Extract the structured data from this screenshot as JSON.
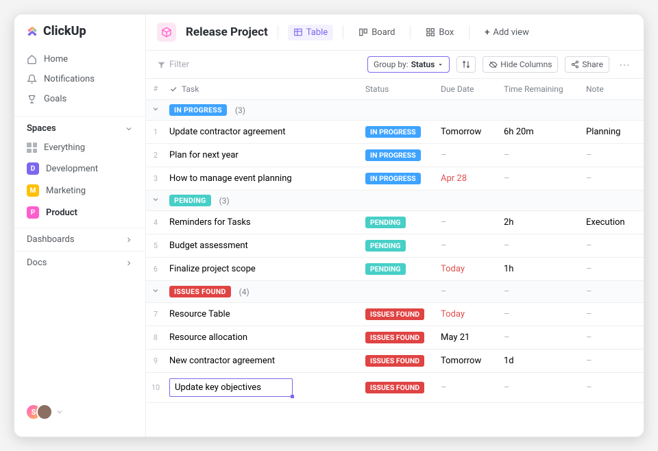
{
  "brand": {
    "name": "ClickUp"
  },
  "sidebar": {
    "nav": [
      {
        "label": "Home"
      },
      {
        "label": "Notifications"
      },
      {
        "label": "Goals"
      }
    ],
    "spaces_header": "Spaces",
    "everything": "Everything",
    "spaces": [
      {
        "letter": "D",
        "label": "Development",
        "color": "#7b68ee"
      },
      {
        "letter": "M",
        "label": "Marketing",
        "color": "#ffc107"
      },
      {
        "letter": "P",
        "label": "Product",
        "color": "#ff5ecd",
        "active": true
      }
    ],
    "dashboards": "Dashboards",
    "docs": "Docs",
    "avatar_letter": "S"
  },
  "header": {
    "project_title": "Release Project",
    "views": [
      {
        "label": "Table",
        "active": true
      },
      {
        "label": "Board"
      },
      {
        "label": "Box"
      }
    ],
    "add_view": "Add view"
  },
  "toolbar": {
    "filter": "Filter",
    "group_by_prefix": "Group by:",
    "group_by_value": "Status",
    "hide_columns": "Hide Columns",
    "share": "Share"
  },
  "columns": {
    "num": "#",
    "task": "Task",
    "status": "Status",
    "due": "Due Date",
    "time": "Time Remaining",
    "note": "Note"
  },
  "status_colors": {
    "IN PROGRESS": "#3ea3ff",
    "PENDING": "#46cfc7",
    "ISSUES FOUND": "#e04343"
  },
  "groups": [
    {
      "status": "IN PROGRESS",
      "count": "(3)",
      "rows": [
        {
          "n": "1",
          "task": "Update contractor agreement",
          "status": "IN PROGRESS",
          "due": "Tomorrow",
          "time": "6h 20m",
          "note": "Planning"
        },
        {
          "n": "2",
          "task": "Plan for next year",
          "status": "IN PROGRESS",
          "due": "–",
          "time": "–",
          "note": "–"
        },
        {
          "n": "3",
          "task": "How to manage event planning",
          "status": "IN PROGRESS",
          "due": "Apr 28",
          "due_red": true,
          "time": "–",
          "note": "–"
        }
      ]
    },
    {
      "status": "PENDING",
      "count": "(3)",
      "rows": [
        {
          "n": "4",
          "task": "Reminders for Tasks",
          "status": "PENDING",
          "due": "–",
          "time": "2h",
          "note": "Execution"
        },
        {
          "n": "5",
          "task": "Budget assessment",
          "status": "PENDING",
          "due": "–",
          "time": "–",
          "note": "–"
        },
        {
          "n": "6",
          "task": "Finalize project scope",
          "status": "PENDING",
          "due": "Today",
          "due_red": true,
          "time": "1h",
          "note": "–"
        }
      ]
    },
    {
      "status": "ISSUES FOUND",
      "count": "(4)",
      "header_extras": {
        "due": "–",
        "time": "–",
        "note": "–"
      },
      "rows": [
        {
          "n": "7",
          "task": "Resource Table",
          "status": "ISSUES FOUND",
          "due": "Today",
          "due_red": true,
          "time": "–",
          "note": "–"
        },
        {
          "n": "8",
          "task": "Resource allocation",
          "status": "ISSUES FOUND",
          "due": "May 21",
          "time": "–",
          "note": "–"
        },
        {
          "n": "9",
          "task": "New contractor agreement",
          "status": "ISSUES FOUND",
          "due": "Tomorrow",
          "time": "1d",
          "note": "–"
        },
        {
          "n": "10",
          "task": "Update key objectives",
          "status": "ISSUES FOUND",
          "due": "–",
          "time": "–",
          "note": "–",
          "selected": true
        }
      ]
    }
  ]
}
